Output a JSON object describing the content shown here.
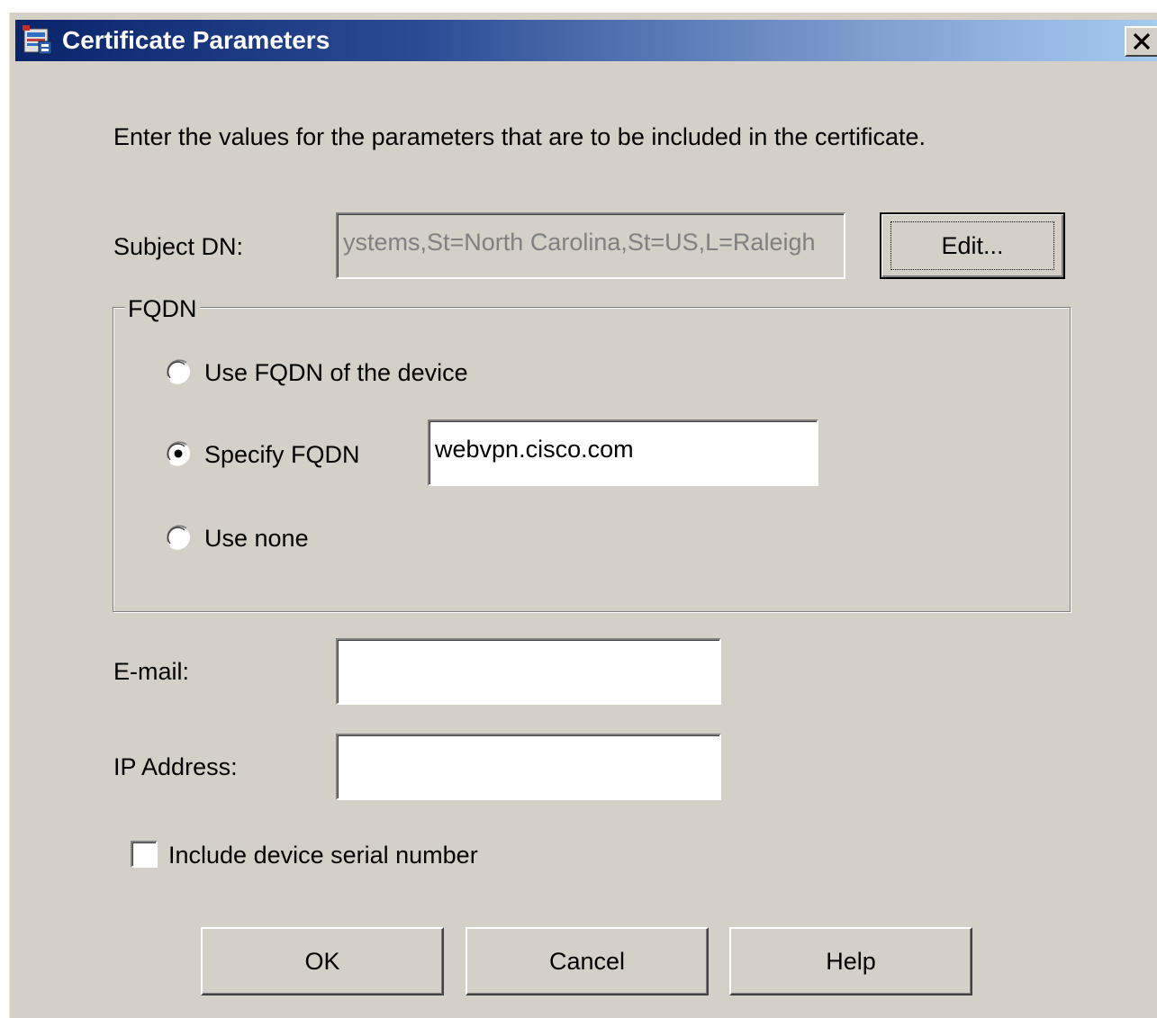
{
  "window": {
    "title": "Certificate Parameters",
    "icon": "application-icon",
    "close_symbol": "✕"
  },
  "instructions": "Enter the values for the parameters that are to be included in the certificate.",
  "subject_dn": {
    "label": "Subject DN:",
    "value": "ystems,St=North Carolina,St=US,L=Raleigh",
    "disabled": true,
    "edit_button": "Edit..."
  },
  "fqdn": {
    "group_label": "FQDN",
    "options": [
      {
        "label": "Use FQDN of the device",
        "selected": false
      },
      {
        "label": "Specify FQDN",
        "selected": true
      },
      {
        "label": "Use none",
        "selected": false
      }
    ],
    "specified_value": "webvpn.cisco.com"
  },
  "email": {
    "label": "E-mail:",
    "value": ""
  },
  "ip_address": {
    "label": "IP Address:",
    "value": ""
  },
  "serial": {
    "label": "Include device serial number",
    "checked": false
  },
  "buttons": {
    "ok": "OK",
    "cancel": "Cancel",
    "help": "Help"
  },
  "colors": {
    "dialog_bg": "#d4d0c8",
    "title_start": "#0a246a",
    "title_end": "#a6caf0"
  }
}
